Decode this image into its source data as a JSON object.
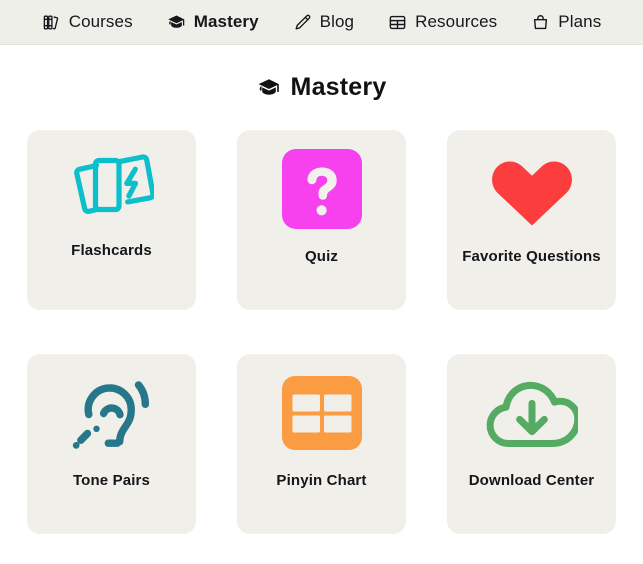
{
  "nav": {
    "items": [
      {
        "label": "Courses",
        "icon": "books-icon",
        "active": false
      },
      {
        "label": "Mastery",
        "icon": "graduation-cap-icon",
        "active": true
      },
      {
        "label": "Blog",
        "icon": "pencil-icon",
        "active": false
      },
      {
        "label": "Resources",
        "icon": "table-grid-icon",
        "active": false
      },
      {
        "label": "Plans",
        "icon": "shopping-bag-icon",
        "active": false
      }
    ]
  },
  "header": {
    "title": "Mastery",
    "icon": "graduation-cap-icon"
  },
  "cards": [
    {
      "label": "Flashcards",
      "icon": "flashcards-icon",
      "color": "#0bbfcb"
    },
    {
      "label": "Quiz",
      "icon": "question-mark-icon",
      "color": "#f741ef"
    },
    {
      "label": "Favorite Questions",
      "icon": "heart-icon",
      "color": "#fb3d3d"
    },
    {
      "label": "Tone Pairs",
      "icon": "ear-hearing-icon",
      "color": "#26778a"
    },
    {
      "label": "Pinyin Chart",
      "icon": "table-chart-icon",
      "color": "#fb9c43"
    },
    {
      "label": "Download Center",
      "icon": "cloud-download-icon",
      "color": "#55ab63"
    }
  ],
  "colors": {
    "page_background": "#ffffff",
    "navbar_background": "#efefea",
    "card_background": "#f0efea",
    "text": "#15161a"
  }
}
